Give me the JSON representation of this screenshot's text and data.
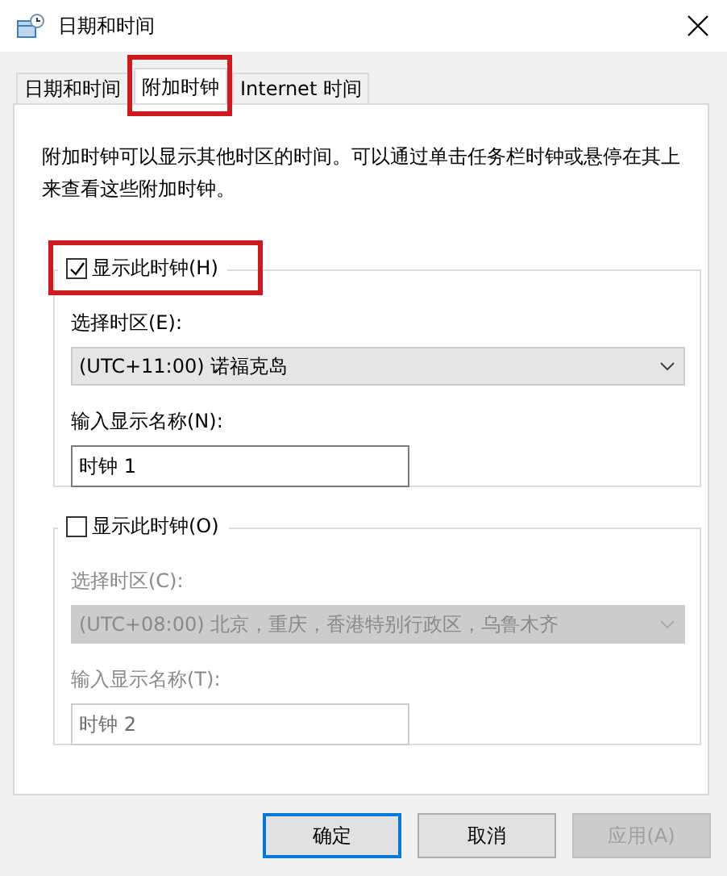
{
  "window": {
    "title": "日期和时间"
  },
  "tabs": [
    {
      "label": "日期和时间",
      "selected": false,
      "highlighted": false
    },
    {
      "label": "附加时钟",
      "selected": true,
      "highlighted": true
    },
    {
      "label": "Internet 时间",
      "selected": false,
      "highlighted": false
    }
  ],
  "description": "附加时钟可以显示其他时区的时间。可以通过单击任务栏时钟或悬停在其上来查看这些附加时钟。",
  "clocks": [
    {
      "checkbox_label": "显示此时钟(H)",
      "checked": true,
      "highlighted": true,
      "timezone_label": "选择时区(E):",
      "timezone": "(UTC+11:00) 诺福克岛",
      "name_label": "输入显示名称(N):",
      "name": "时钟 1"
    },
    {
      "checkbox_label": "显示此时钟(O)",
      "checked": false,
      "highlighted": false,
      "timezone_label": "选择时区(C):",
      "timezone": "(UTC+08:00) 北京，重庆，香港特别行政区，乌鲁木齐",
      "name_label": "输入显示名称(T):",
      "name": "时钟 2"
    }
  ],
  "buttons": [
    {
      "label": "确定",
      "kind": "default",
      "disabled": false
    },
    {
      "label": "取消",
      "kind": "normal",
      "disabled": false
    },
    {
      "label": "应用(A)",
      "kind": "normal",
      "disabled": true
    }
  ]
}
